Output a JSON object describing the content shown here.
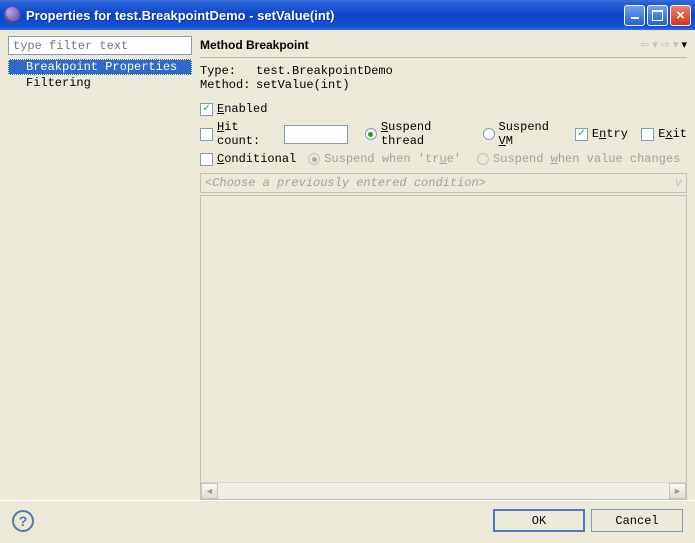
{
  "window": {
    "title": "Properties for test.BreakpointDemo - setValue(int)"
  },
  "filter": {
    "placeholder": "type filter text"
  },
  "tree": {
    "items": [
      {
        "label": "Breakpoint Properties",
        "selected": true
      },
      {
        "label": "Filtering",
        "selected": false
      }
    ]
  },
  "section": {
    "title": "Method Breakpoint"
  },
  "info": {
    "type_label": "Type:",
    "type_value": "test.BreakpointDemo",
    "method_label": "Method:",
    "method_value": "setValue(int)"
  },
  "options": {
    "enabled": {
      "label": "Enabled",
      "checked": true
    },
    "hit_count": {
      "label": "Hit count:",
      "checked": false,
      "value": ""
    },
    "suspend_thread": {
      "label": "Suspend thread",
      "checked": true
    },
    "suspend_vm": {
      "label": "Suspend VM",
      "checked": false
    },
    "entry": {
      "label": "Entry",
      "checked": true
    },
    "exit": {
      "label": "Exit",
      "checked": false
    },
    "conditional": {
      "label": "Conditional",
      "checked": false
    },
    "suspend_when_true": {
      "label": "Suspend when 'true'",
      "checked": true
    },
    "suspend_when_changes": {
      "label": "Suspend when value changes",
      "checked": false
    }
  },
  "condition_combo": {
    "placeholder": "<Choose a previously entered condition>"
  },
  "buttons": {
    "ok": "OK",
    "cancel": "Cancel"
  }
}
